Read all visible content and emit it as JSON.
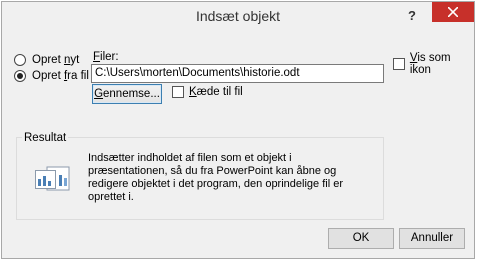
{
  "dialog": {
    "title": "Indsæt objekt",
    "help_label": "?"
  },
  "options": {
    "create_new": {
      "pre": "Opret ",
      "accel": "n",
      "post": "yt"
    },
    "create_from_file": {
      "pre": "Opret ",
      "accel": "f",
      "post": "ra fil"
    },
    "selected": "create_from_file"
  },
  "file": {
    "label_accel": "F",
    "label_rest": "iler:",
    "path": "C:\\Users\\morten\\Documents\\historie.odt",
    "browse_accel": "G",
    "browse_rest": "ennemse...",
    "link_accel": "K",
    "link_rest": "æde til fil"
  },
  "display_as_icon": {
    "accel": "V",
    "rest": "is som ikon",
    "checked": false
  },
  "result": {
    "label": "Resultat",
    "text": "Indsætter indholdet af filen som et objekt i præsentationen, så du fra PowerPoint kan åbne og redigere objektet i det program, den oprindelige fil er oprettet i."
  },
  "buttons": {
    "ok": "OK",
    "cancel": "Annuller"
  },
  "colors": {
    "close_button": "#c7302a",
    "focus_border": "#3c7fb1"
  }
}
